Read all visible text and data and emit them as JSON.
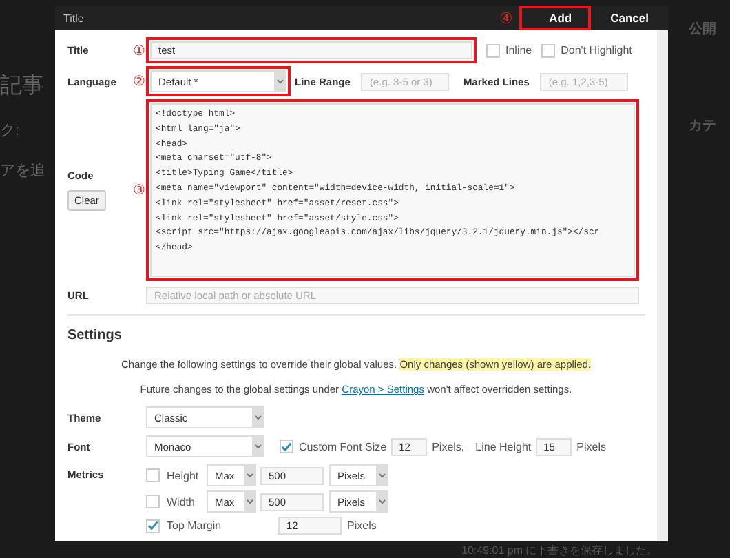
{
  "background": {
    "left_texts": [
      "記事",
      "ク:",
      "アを追"
    ],
    "right_texts": [
      "公開",
      "カテ"
    ],
    "status": "10:49:01 pm に下書きを保存しました。"
  },
  "dialog": {
    "title": "Title",
    "add_annotation": "④",
    "buttons": [
      {
        "label": "Add",
        "highlighted": true
      },
      {
        "label": "Cancel",
        "highlighted": false
      }
    ]
  },
  "title_row": {
    "label": "Title",
    "annotation": "①",
    "value": "test",
    "options": [
      {
        "label": "Inline",
        "checked": false
      },
      {
        "label": "Don't Highlight",
        "checked": false
      }
    ]
  },
  "language_row": {
    "label": "Language",
    "annotation": "②",
    "value": "Default *",
    "line_range": {
      "label": "Line Range",
      "placeholder": "(e.g. 3-5 or 3)"
    },
    "marked_lines": {
      "label": "Marked Lines",
      "placeholder": "(e.g. 1,2,3-5)"
    }
  },
  "code_row": {
    "label": "Code",
    "clear": "Clear",
    "annotation": "③",
    "lines": [
      "<!doctype html>",
      "<html lang=\"ja\">",
      "<head>",
      "<meta charset=\"utf-8\">",
      "<title>Typing Game</title>",
      "<meta name=\"viewport\" content=\"width=device-width, initial-scale=1\">",
      "<link rel=\"stylesheet\" href=\"asset/reset.css\">",
      "<link rel=\"stylesheet\" href=\"asset/style.css\">",
      "<script src=\"https://ajax.googleapis.com/ajax/libs/jquery/3.2.1/jquery.min.js\"></scr",
      "</head>"
    ]
  },
  "url_row": {
    "label": "URL",
    "placeholder": "Relative local path or absolute URL"
  },
  "settings": {
    "heading": "Settings",
    "note_plain": "Change the following settings to override their global values.",
    "note_highlight": "Only changes (shown yellow) are applied.",
    "note2_before": "Future changes to the global settings under",
    "note2_link": "Crayon > Settings",
    "note2_after": "won't affect overridden settings.",
    "theme": {
      "label": "Theme",
      "value": "Classic"
    },
    "font": {
      "label": "Font",
      "value": "Monaco",
      "custom_size": {
        "label": "Custom Font Size",
        "checked": true,
        "value": "12",
        "unit": "Pixels,"
      },
      "line_height": {
        "label": "Line Height",
        "value": "15",
        "unit": "Pixels"
      }
    },
    "metrics": {
      "label": "Metrics",
      "rows": [
        {
          "kind": "select",
          "label": "Height",
          "checked": false,
          "mode": "Max",
          "value": "500",
          "unit": "Pixels"
        },
        {
          "kind": "select",
          "label": "Width",
          "checked": false,
          "mode": "Max",
          "value": "500",
          "unit": "Pixels"
        },
        {
          "kind": "plain",
          "label": "Top Margin",
          "checked": true,
          "value": "12",
          "unit": "Pixels"
        }
      ]
    }
  }
}
